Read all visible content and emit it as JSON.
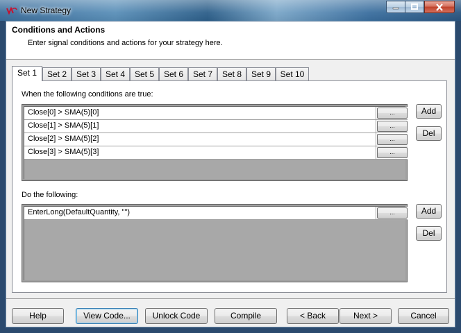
{
  "window": {
    "title": "New Strategy"
  },
  "header": {
    "title": "Conditions and Actions",
    "subtitle": "Enter signal conditions and actions for your strategy here."
  },
  "tabs": [
    {
      "label": "Set 1",
      "active": true
    },
    {
      "label": "Set 2"
    },
    {
      "label": "Set 3"
    },
    {
      "label": "Set 4"
    },
    {
      "label": "Set 5"
    },
    {
      "label": "Set 6"
    },
    {
      "label": "Set 7"
    },
    {
      "label": "Set 8"
    },
    {
      "label": "Set 9"
    },
    {
      "label": "Set 10"
    }
  ],
  "conditions": {
    "label": "When the following conditions are true:",
    "rows": [
      "Close[0] > SMA(5)[0]",
      "Close[1] > SMA(5)[1]",
      "Close[2] > SMA(5)[2]",
      "Close[3] > SMA(5)[3]"
    ],
    "ellipsis": "...",
    "add": "Add",
    "del": "Del"
  },
  "actions": {
    "label": "Do the following:",
    "rows": [
      "EnterLong(DefaultQuantity, \"\")"
    ],
    "ellipsis": "...",
    "add": "Add",
    "del": "Del"
  },
  "buttons": {
    "help": "Help",
    "view_code": "View Code...",
    "unlock_code": "Unlock Code",
    "compile": "Compile",
    "back": "< Back",
    "next": "Next >",
    "cancel": "Cancel"
  },
  "colors": {
    "grid_bg": "#a8a8a8",
    "close_button": "#c0412a"
  }
}
